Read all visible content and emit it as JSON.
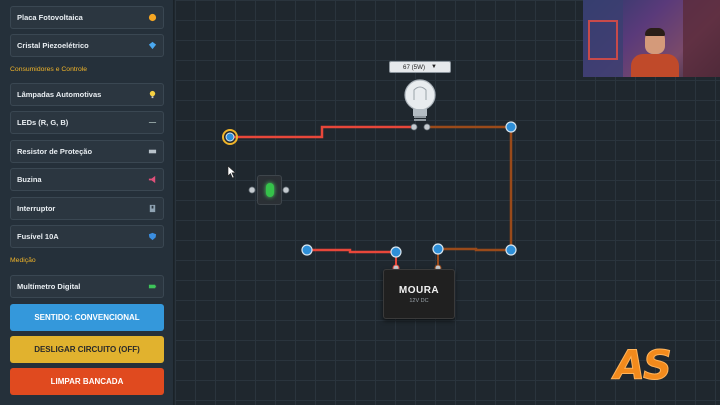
{
  "sidebar": {
    "sources": [
      {
        "label": "Placa Fotovoltaica",
        "icon": "sun-icon"
      },
      {
        "label": "Cristal Piezoelétrico",
        "icon": "crystal-icon"
      }
    ],
    "section_consumers": "Consumidores e Controle",
    "consumers": [
      {
        "label": "Lâmpadas Automotivas",
        "icon": "bulb-icon"
      },
      {
        "label": "LEDs (R, G, B)",
        "icon": "led-icon"
      },
      {
        "label": "Resistor de Proteção",
        "icon": "resistor-icon"
      },
      {
        "label": "Buzina",
        "icon": "horn-icon"
      },
      {
        "label": "Interruptor",
        "icon": "switch-icon"
      },
      {
        "label": "Fusível 10A",
        "icon": "shield-icon"
      }
    ],
    "section_measure": "Medição",
    "measure": [
      {
        "label": "Multímetro Digital",
        "icon": "battery-icon"
      }
    ]
  },
  "buttons": {
    "sentido": "SENTIDO: CONVENCIONAL",
    "desligar": "DESLIGAR CIRCUITO (OFF)",
    "limpar": "LIMPAR BANCADA"
  },
  "workspace": {
    "bulb_select": "67 (5W)",
    "battery_brand": "MOURA",
    "battery_spec": "12V DC"
  },
  "overlay": {
    "logo_text": "AS"
  },
  "colors": {
    "wire_red": "#e8473a",
    "wire_brown": "#9a4a1a",
    "terminal_blue": "#2e8fd8",
    "accent_yellow": "#f0b429"
  }
}
